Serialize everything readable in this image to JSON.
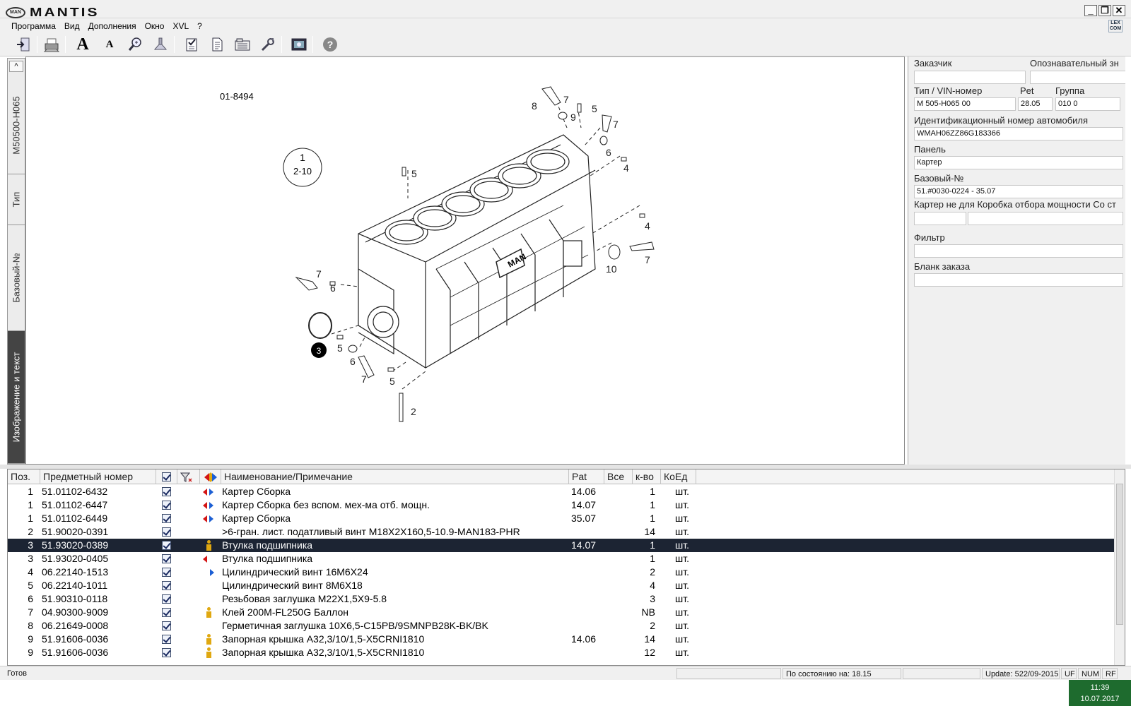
{
  "app": {
    "title": "MANTIS",
    "logo_text": "MAN",
    "lex_logo": "LEX COM"
  },
  "window_buttons": [
    "_",
    "❐",
    "✕"
  ],
  "menu": [
    "Программа",
    "Вид",
    "Дополнения",
    "Окно",
    "XVL",
    "?"
  ],
  "toolbar_icons": [
    "exit-icon",
    "print-icon",
    "font-large-icon",
    "font-small-icon",
    "zoom-icon",
    "flashlight-icon",
    "checklist-icon",
    "document-icon",
    "catalog-icon",
    "tools-icon",
    "picture-icon",
    "help-icon"
  ],
  "toolbar_glyphs": {
    "font_large": "A",
    "font_small": "A",
    "help": "?"
  },
  "vtabs": {
    "up": "^",
    "items": [
      "M50500-H065",
      "Тип",
      "Базовый-№",
      "Изображение и текст"
    ],
    "active": 3
  },
  "drawing": {
    "ref_number": "01-8494",
    "circle_top": "1",
    "circle_bottom": "2-10",
    "callout_selected": "3",
    "engine_label": "MAN",
    "part_labels": [
      "7",
      "8",
      "9",
      "5",
      "7",
      "6",
      "4",
      "5",
      "4",
      "10",
      "7",
      "7",
      "6",
      "5",
      "6",
      "7",
      "5",
      "2"
    ]
  },
  "info": {
    "customer_label": "Заказчик",
    "customer_value": "",
    "ident_label": "Опознавательный зн",
    "ident_value": "",
    "type_vin_label": "Тип / VIN-номер",
    "type_vin_value": "M 505-H065 00",
    "pet_label": "Pet",
    "pet_value": "28.05",
    "group_label": "Группа",
    "group_value": "010 0",
    "vehicle_id_label": "Идентификационный номер автомобиля",
    "vehicle_id_value": "WMAH06ZZ86G183366",
    "panel_label": "Панель",
    "panel_value": "Картер",
    "base_no_label": "Базовый-№",
    "base_no_value": "51.#0030-0224  - 35.07",
    "description": "Картер не для Коробка отбора мощности Со ст",
    "filter_label": "Фильтр",
    "filter_value": "",
    "order_form_label": "Бланк заказа",
    "order_form_value": ""
  },
  "table": {
    "columns": [
      "Поз.",
      "Предметный номер",
      "",
      "",
      "",
      "Наименование/Примечание",
      "Pat",
      "Все",
      "к-во",
      "КоЕд"
    ],
    "selected_row": 4,
    "rows": [
      {
        "pos": "1",
        "part": "51.01102-6432",
        "flag": "both",
        "name": "Картер Сборка",
        "pat": "14.06",
        "qty": "1",
        "unit": "шт."
      },
      {
        "pos": "1",
        "part": "51.01102-6447",
        "flag": "both",
        "name": "Картер Сборка без вспом. мех-ма отб. мощн.",
        "pat": "14.07",
        "qty": "1",
        "unit": "шт."
      },
      {
        "pos": "1",
        "part": "51.01102-6449",
        "flag": "both",
        "name": "Картер Сборка",
        "pat": "35.07",
        "qty": "1",
        "unit": "шт."
      },
      {
        "pos": "2",
        "part": "51.90020-0391",
        "flag": "",
        "name": "  >6-гран. лист. податливый винт M18X2X160,5-10.9-MAN183-PHR",
        "pat": "",
        "qty": "14",
        "unit": "шт."
      },
      {
        "pos": "3",
        "part": "51.93020-0389",
        "flag": "info",
        "name": "Втулка подшипника",
        "pat": "14.07",
        "qty": "1",
        "unit": "шт."
      },
      {
        "pos": "3",
        "part": "51.93020-0405",
        "flag": "left",
        "name": "Втулка подшипника",
        "pat": "",
        "qty": "1",
        "unit": "шт."
      },
      {
        "pos": "4",
        "part": "06.22140-1513",
        "flag": "right",
        "name": "Цилиндрический винт 16M6X24",
        "pat": "",
        "qty": "2",
        "unit": "шт."
      },
      {
        "pos": "5",
        "part": "06.22140-1011",
        "flag": "",
        "name": "Цилиндрический винт 8M6X18",
        "pat": "",
        "qty": "4",
        "unit": "шт."
      },
      {
        "pos": "6",
        "part": "51.90310-0118",
        "flag": "",
        "name": "Резьбовая заглушка M22X1,5X9-5.8",
        "pat": "",
        "qty": "3",
        "unit": "шт."
      },
      {
        "pos": "7",
        "part": "04.90300-9009",
        "flag": "info",
        "name": "Клей 200M-FL250G Баллон",
        "pat": "",
        "qty": "NB",
        "unit": "шт."
      },
      {
        "pos": "8",
        "part": "06.21649-0008",
        "flag": "",
        "name": "Герметичная заглушка 10X6,5-C15PB/9SMNPB28K-BK/BK",
        "pat": "",
        "qty": "2",
        "unit": "шт."
      },
      {
        "pos": "9",
        "part": "51.91606-0036",
        "flag": "info",
        "name": "Запорная крышка A32,3/10/1,5-X5CRNI1810",
        "pat": "14.06",
        "qty": "14",
        "unit": "шт."
      },
      {
        "pos": "9",
        "part": "51.91606-0036",
        "flag": "info",
        "name": "Запорная крышка A32,3/10/1,5-X5CRNI1810",
        "pat": "",
        "qty": "12",
        "unit": "шт."
      }
    ]
  },
  "status": {
    "ready": "Готов",
    "state_as_of": "По состоянию на: 18.15",
    "update": "Update: 522/09-2015",
    "uf": "UF",
    "num": "NUM",
    "rf": "RF"
  },
  "clock": {
    "time": "11:39",
    "date": "10.07.2017"
  }
}
